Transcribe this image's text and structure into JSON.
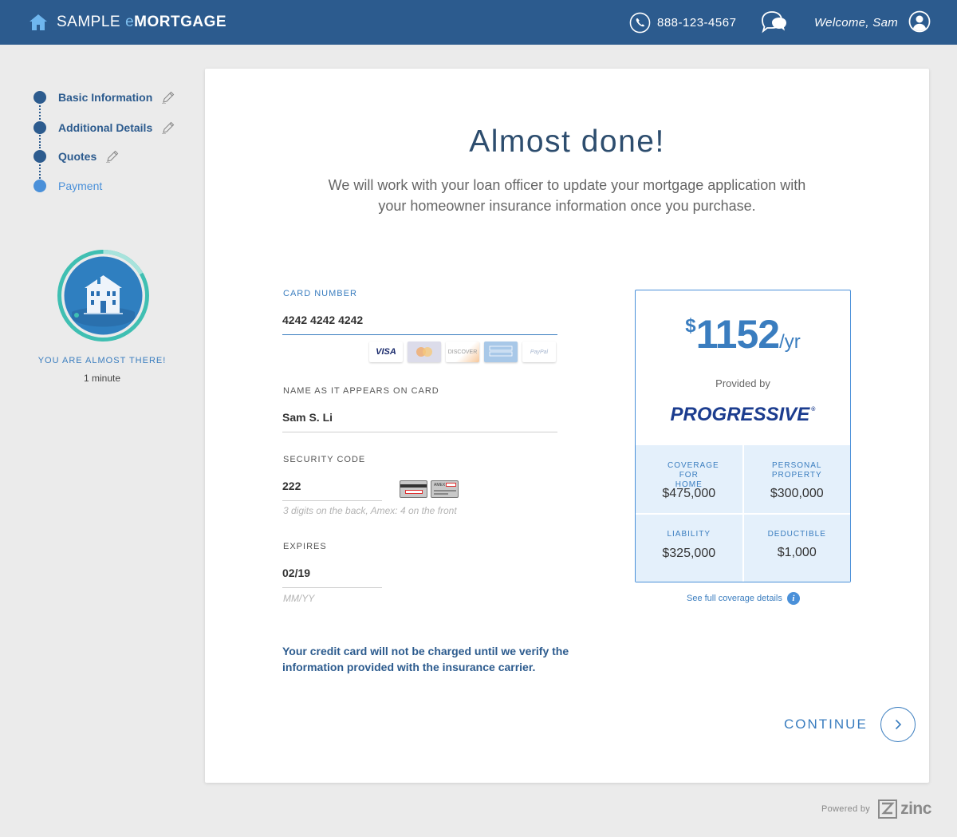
{
  "header": {
    "brand_part1": "SAMPLE",
    "brand_part2": "e",
    "brand_part3": "MORTGAGE",
    "phone": "888-123-4567",
    "welcome": "Welcome, Sam"
  },
  "steps": [
    {
      "label": "Basic Information",
      "state": "complete"
    },
    {
      "label": "Additional Details",
      "state": "complete"
    },
    {
      "label": "Quotes",
      "state": "complete"
    },
    {
      "label": "Payment",
      "state": "current"
    }
  ],
  "progress": {
    "message": "YOU ARE ALMOST THERE!",
    "time_left": "1 minute"
  },
  "main": {
    "title": "Almost done!",
    "subtitle": "We will work with your loan officer to update your mortgage application with your homeowner insurance information once you purchase."
  },
  "form": {
    "card_number_label": "CARD NUMBER",
    "card_number_value": "4242 4242 4242",
    "card_logos": [
      "VISA",
      "MasterCard",
      "DISCOVER",
      "AMERICAN EXPRESS",
      "PayPal"
    ],
    "name_label": "NAME AS IT APPEARS ON CARD",
    "name_value": "Sam S. Li",
    "security_label": "SECURITY CODE",
    "security_value": "222",
    "security_hint": "3 digits on the back, Amex: 4 on the front",
    "security_card_amex": "AMEX",
    "expires_label": "EXPIRES",
    "expires_value": "02/19",
    "expires_hint": "MM/YY",
    "disclaimer": "Your credit card will not be charged until we verify the information provided with the insurance carrier."
  },
  "quote": {
    "currency": "$",
    "amount": "1152",
    "period": "/yr",
    "provided_by": "Provided by",
    "carrier": "PROGRESSIVE",
    "carrier_mark": "®",
    "coverage": [
      {
        "label": "COVERAGE FOR HOME",
        "value": "$475,000"
      },
      {
        "label": "PERSONAL PROPERTY",
        "value": "$300,000"
      },
      {
        "label": "LIABILITY",
        "value": "$325,000"
      },
      {
        "label": "DEDUCTIBLE",
        "value": "$1,000"
      }
    ],
    "see_full": "See full coverage details",
    "info_glyph": "i"
  },
  "actions": {
    "continue_label": "CONTINUE"
  },
  "footer": {
    "powered_by": "Powered by",
    "vendor": "zinc"
  },
  "colors": {
    "header_bg": "#2c5b8e",
    "accent": "#3a7dbf",
    "page_bg": "#ebebeb",
    "coverage_bg": "#e4f0fb"
  },
  "icons": {
    "brand": "home-icon",
    "phone": "phone-icon",
    "chat": "chat-bubbles-icon",
    "user": "user-circle-icon",
    "edit": "pencil-icon",
    "badge": "house-illustration-icon",
    "continue": "chevron-right-icon",
    "footer": "zinc-logo-icon"
  }
}
